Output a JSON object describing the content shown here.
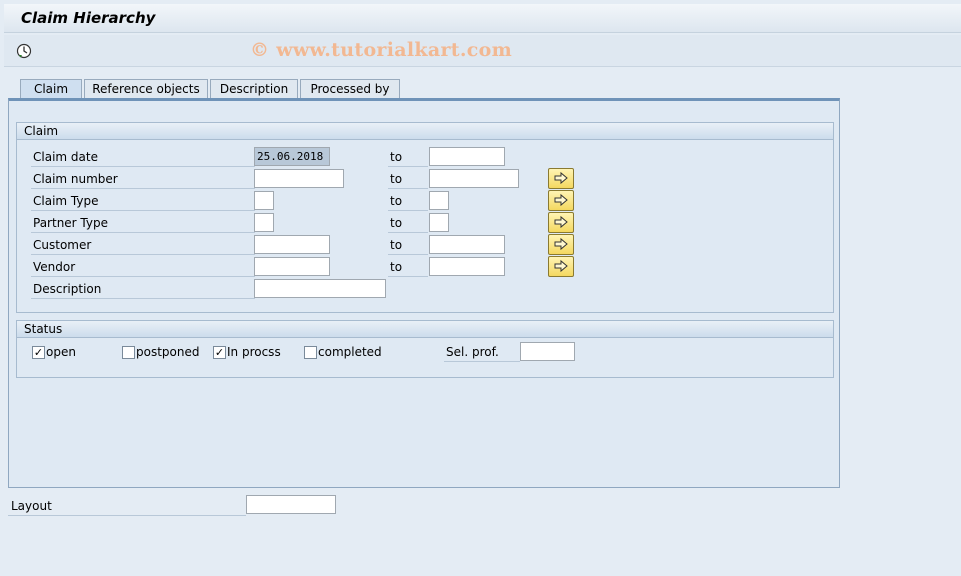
{
  "window": {
    "title": "Claim Hierarchy"
  },
  "toolbar": {
    "execute_icon": "execute-clock-icon",
    "watermark": "© www.tutorialkart.com"
  },
  "tabs": [
    {
      "label": "Claim"
    },
    {
      "label": "Reference objects"
    },
    {
      "label": "Description"
    },
    {
      "label": "Processed by"
    }
  ],
  "claim_group": {
    "title": "Claim",
    "to_label": "to",
    "fields": [
      {
        "label": "Claim date",
        "from": "25.06.2018",
        "to": ""
      },
      {
        "label": "Claim number",
        "from": "",
        "to": ""
      },
      {
        "label": "Claim Type",
        "from": "",
        "to": ""
      },
      {
        "label": "Partner Type",
        "from": "",
        "to": ""
      },
      {
        "label": "Customer",
        "from": "",
        "to": ""
      },
      {
        "label": "Vendor",
        "from": "",
        "to": ""
      },
      {
        "label": "Description",
        "from": ""
      }
    ]
  },
  "status_group": {
    "title": "Status",
    "checkboxes": [
      {
        "label": "open",
        "checked": true
      },
      {
        "label": "postponed",
        "checked": false
      },
      {
        "label": "In procss",
        "checked": true
      },
      {
        "label": "completed",
        "checked": false
      }
    ],
    "sel_prof_label": "Sel. prof.",
    "sel_prof_value": ""
  },
  "layout": {
    "label": "Layout",
    "value": ""
  },
  "colors": {
    "accent": "#6f93b8",
    "button": "#f4d860",
    "panel": "#dfe9f3"
  }
}
